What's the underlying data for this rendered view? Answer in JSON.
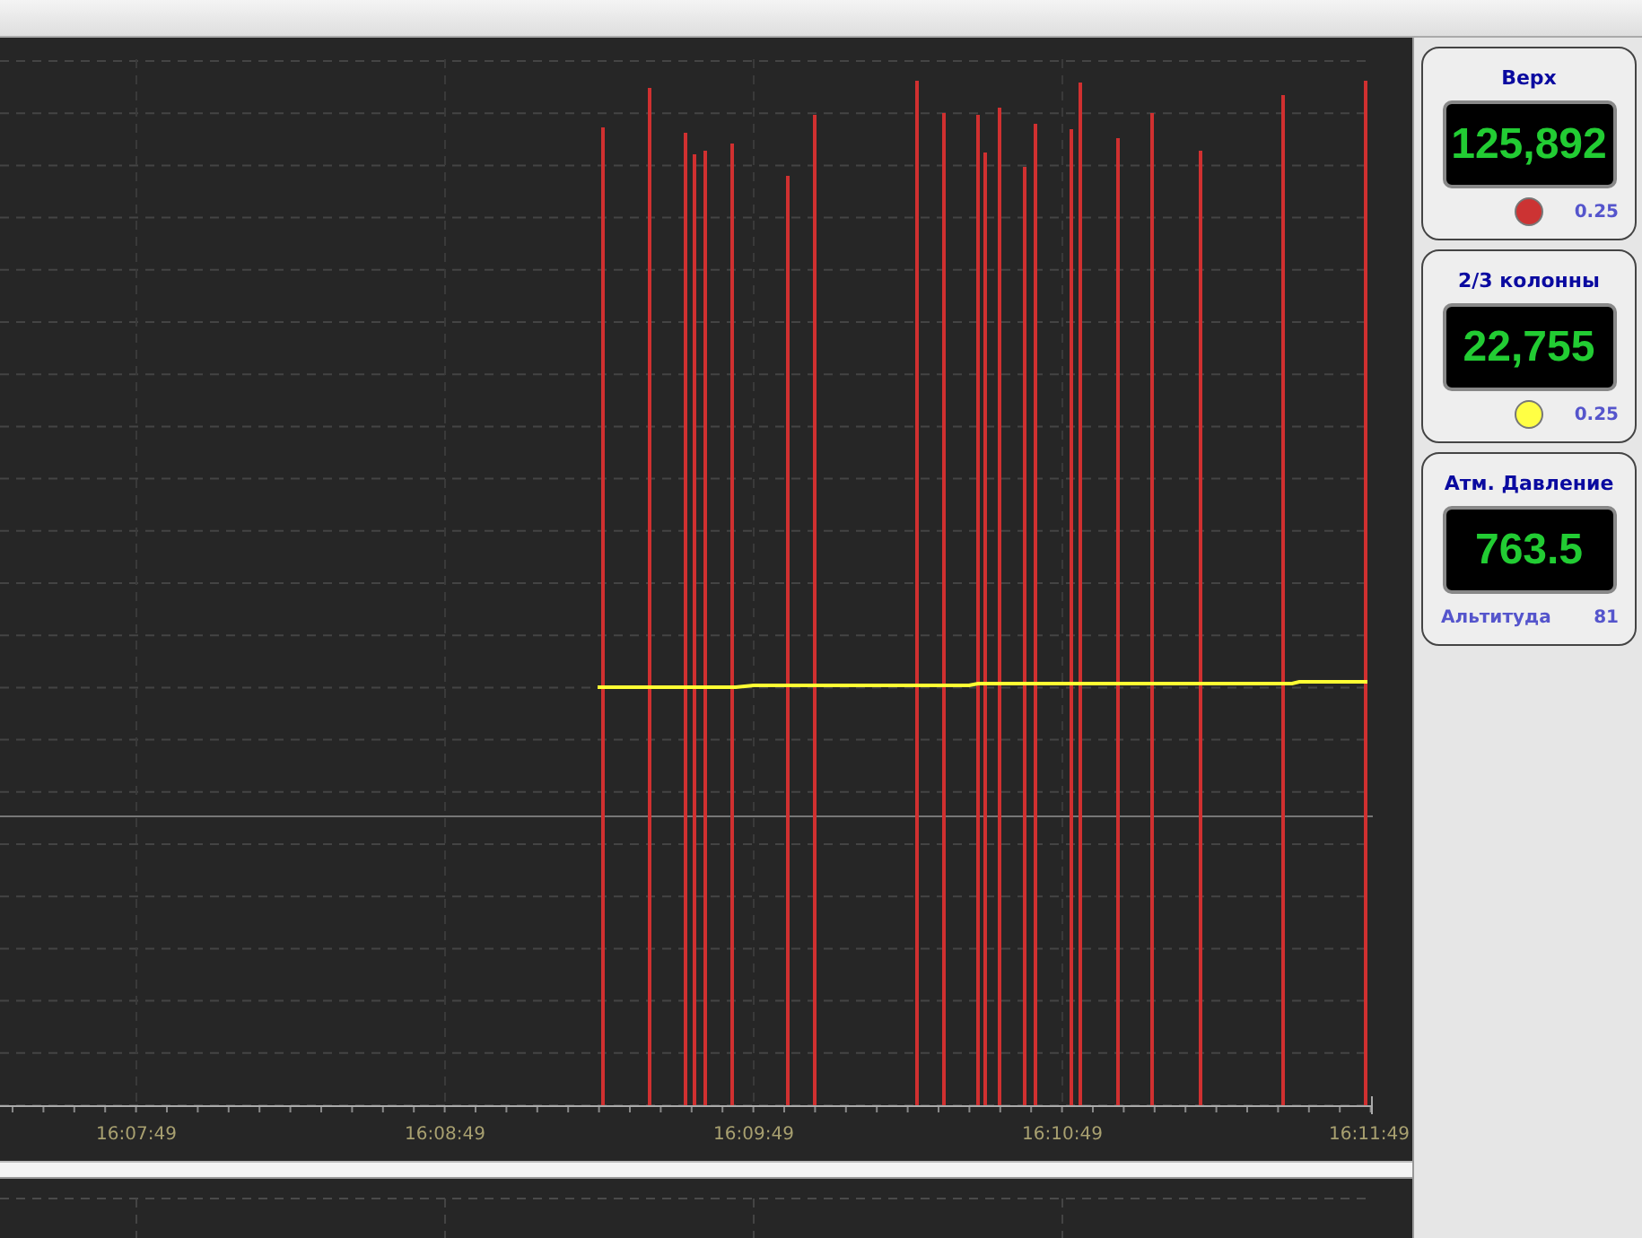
{
  "chart": {
    "x_labels": [
      "16:07:49",
      "16:08:49",
      "16:09:49",
      "16:10:49",
      "16:11:49"
    ]
  },
  "sensors": [
    {
      "kind": "indicator",
      "title": "Верх",
      "value": "125,892",
      "color": "#cc3333",
      "reading": "0.25"
    },
    {
      "kind": "indicator",
      "title": "2/3 колонны",
      "value": "22,755",
      "color": "#ffff44",
      "reading": "0.25"
    },
    {
      "kind": "caption",
      "title": "Атм. Давление",
      "value": "763.5",
      "caption": "Альтитуда",
      "reading": "81"
    }
  ]
}
